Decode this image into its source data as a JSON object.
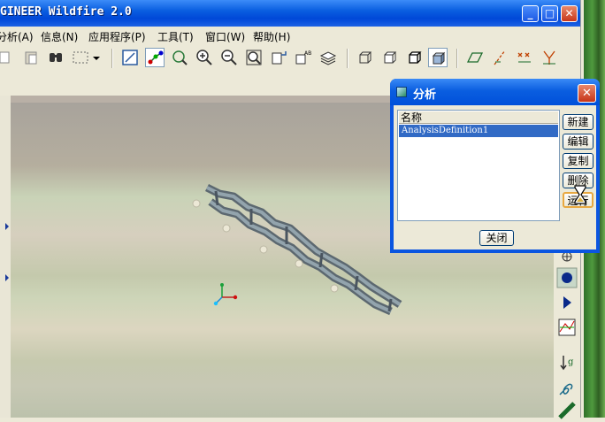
{
  "window": {
    "title": "GINEER Wildfire 2.0",
    "controls": {
      "minimize": "_",
      "maximize": "□",
      "close": "✕"
    }
  },
  "menu": [
    "分析(A)",
    "信息(N)",
    "应用程序(P)",
    "工具(T)",
    "窗口(W)",
    "帮助(H)"
  ],
  "toolbar_icons": [
    "copy-icon",
    "paste-icon",
    "find-icon",
    "select-box-icon",
    "dropdown-arrow-icon",
    "repaint-icon",
    "spin-center-icon",
    "orient-icon",
    "zoom-in-icon",
    "zoom-out-icon",
    "refit-icon",
    "view-manager-icon",
    "saved-views-icon",
    "layers-icon",
    "wireframe-icon",
    "hidden-line-icon",
    "no-hidden-icon",
    "shading-icon",
    "datum-planes-icon",
    "datum-axes-icon",
    "datum-points-icon",
    "coordinate-systems-icon"
  ],
  "right_tools": [
    "drag-icon",
    "servo-motor-icon",
    "run-analysis-icon",
    "measure-icon",
    "gravity-icon",
    "spring-icon",
    "damper-icon"
  ],
  "dialog": {
    "title": "分析",
    "close_glyph": "✕",
    "list_header": "名称",
    "items": [
      "AnalysisDefinition1"
    ],
    "buttons": {
      "new": "新建",
      "edit": "编辑",
      "copy": "复制",
      "delete": "删除",
      "run": "运行"
    },
    "close_button": "关闭"
  },
  "colors": {
    "xp_blue": "#0a5ee0",
    "selection": "#316ac5",
    "dialog_bg": "#ece9d8"
  }
}
